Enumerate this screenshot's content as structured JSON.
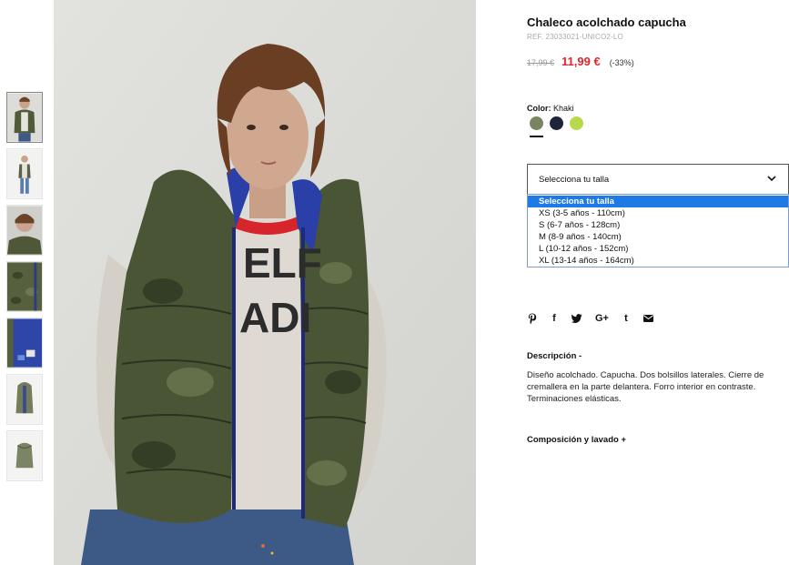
{
  "product": {
    "title": "Chaleco acolchado capucha",
    "ref": "REF. 23033021-UNICO2-LO",
    "old_price": "17,99 €",
    "new_price": "11,99 €",
    "discount": "(-33%)"
  },
  "color": {
    "label": "Color:",
    "selected": "Khaki",
    "swatches": [
      {
        "name": "khaki",
        "hex": "#7a8460"
      },
      {
        "name": "navy",
        "hex": "#1f2538"
      },
      {
        "name": "lime",
        "hex": "#b7d94b"
      }
    ]
  },
  "size": {
    "select_label": "Selecciona tu talla",
    "options": [
      "Selecciona tu talla",
      "XS (3-5 años - 110cm)",
      "S (6-7 años - 128cm)",
      "M (8-9 años - 140cm)",
      "L (10-12 años - 152cm)",
      "XL (13-14 años - 164cm)"
    ]
  },
  "share": {
    "icons": [
      "pinterest-icon",
      "facebook-icon",
      "twitter-icon",
      "google-plus-icon",
      "tumblr-icon",
      "email-icon"
    ],
    "facebook": "f",
    "google_plus": "G+",
    "tumblr": "t"
  },
  "description": {
    "heading": "Descripción -",
    "body": "Diseño acolchado. Capucha. Dos bolsillos laterales. Cierre de cremallera en la parte delantera. Forro interior en contraste. Terminaciones elásticas."
  },
  "composition": {
    "heading": "Composición y lavado +"
  },
  "colors": {
    "accent_price": "#e0252b",
    "dropdown_highlight": "#1e7be6"
  }
}
